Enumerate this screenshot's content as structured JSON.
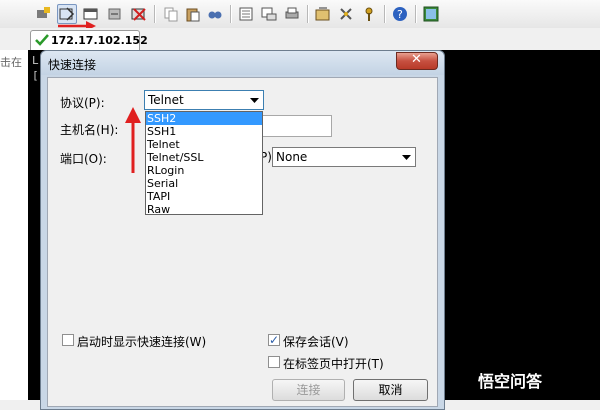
{
  "tab": {
    "label": "172.17.102.152"
  },
  "terminal": {
    "left_fragment": "击在",
    "line1": "L:",
    "line2": "["
  },
  "dialog": {
    "title": "快速连接",
    "close_glyph": "✕",
    "protocol_label": "协议(P):",
    "protocol_value": "Telnet",
    "hostname_label": "主机名(H):",
    "hostname_value": "",
    "port_label": "端口(O):",
    "firewall_label": "P):",
    "firewall_value": "None",
    "protocol_options": [
      "SSH2",
      "SSH1",
      "Telnet",
      "Telnet/SSL",
      "RLogin",
      "Serial",
      "TAPI",
      "Raw"
    ],
    "selected_option": "SSH2",
    "show_on_startup_label": "启动时显示快速连接(W)",
    "show_on_startup_checked": false,
    "save_session_label": "保存会话(V)",
    "save_session_checked": true,
    "open_in_tab_label": "在标签页中打开(T)",
    "open_in_tab_checked": false,
    "connect_button": "连接",
    "cancel_button": "取消"
  },
  "watermark": {
    "text": "悟空问答"
  },
  "colors": {
    "annotation_red": "#e02020",
    "selection_blue": "#3399ff",
    "check_green": "#2a9a2a"
  }
}
